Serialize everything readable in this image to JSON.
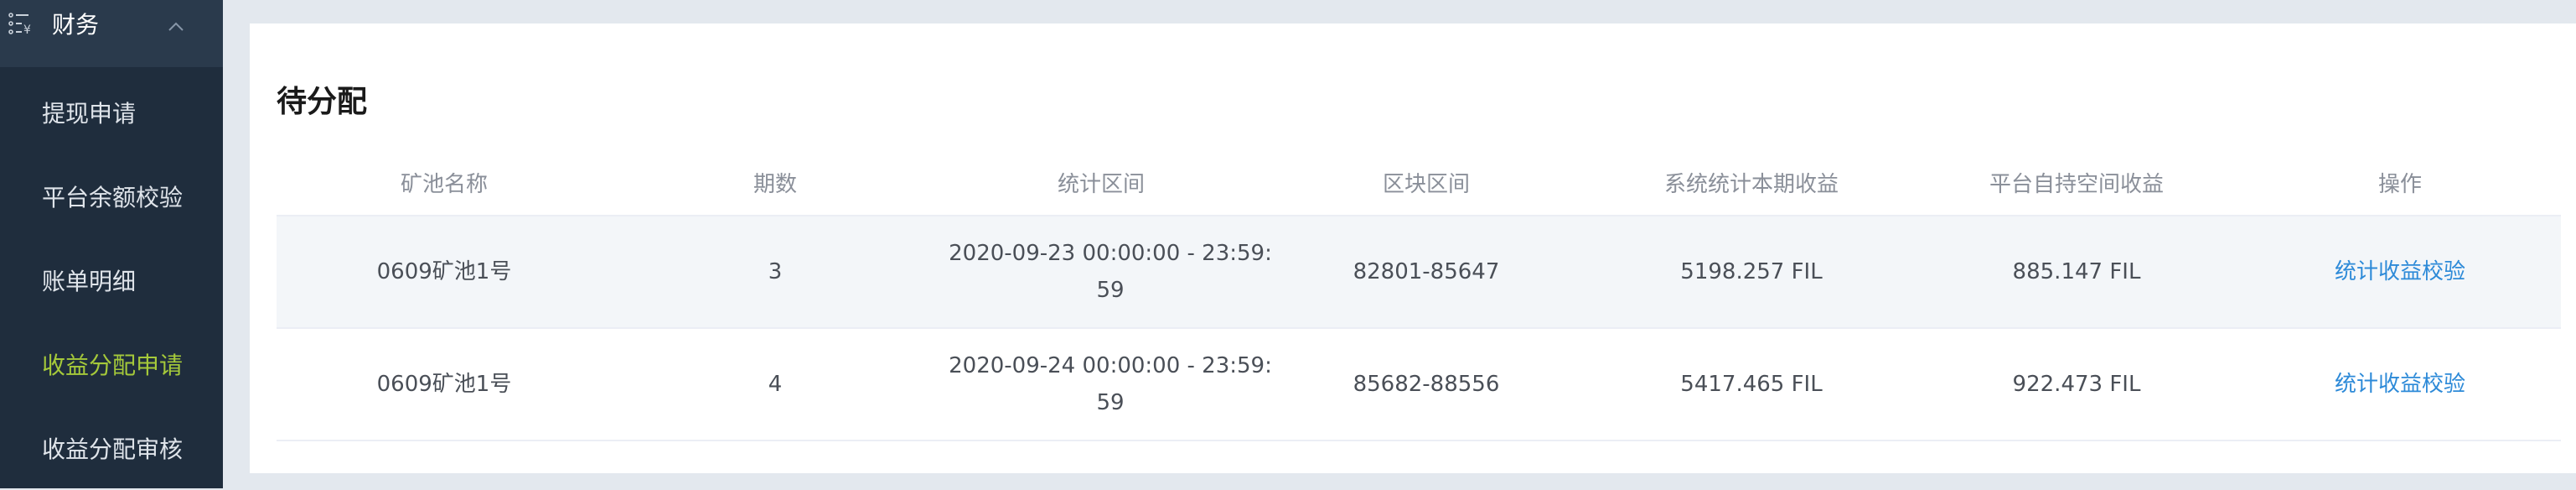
{
  "sidebar": {
    "parent": {
      "label": "财务",
      "icon": "finance-list-icon"
    },
    "items": [
      {
        "label": "提现申请",
        "active": false
      },
      {
        "label": "平台余额校验",
        "active": false
      },
      {
        "label": "账单明细",
        "active": false
      },
      {
        "label": "收益分配申请",
        "active": true
      },
      {
        "label": "收益分配审核",
        "active": false
      }
    ],
    "active_color": "#a5c93a"
  },
  "main": {
    "title": "待分配",
    "table": {
      "columns": [
        "矿池名称",
        "期数",
        "统计区间",
        "区块区间",
        "系统统计本期收益",
        "平台自持空间收益",
        "操作"
      ],
      "rows": [
        {
          "pool": "0609矿池1号",
          "period": "3",
          "range": "2020-09-23 00:00:00 - 23:59:59",
          "blocks": "82801-85647",
          "system_income": "5198.257 FIL",
          "platform_income": "885.147 FIL",
          "action": "统计收益校验"
        },
        {
          "pool": "0609矿池1号",
          "period": "4",
          "range": "2020-09-24 00:00:00 - 23:59:59",
          "blocks": "85682-88556",
          "system_income": "5417.465 FIL",
          "platform_income": "922.473 FIL",
          "action": "统计收益校验"
        }
      ]
    },
    "link_color": "#2d8ad8"
  }
}
